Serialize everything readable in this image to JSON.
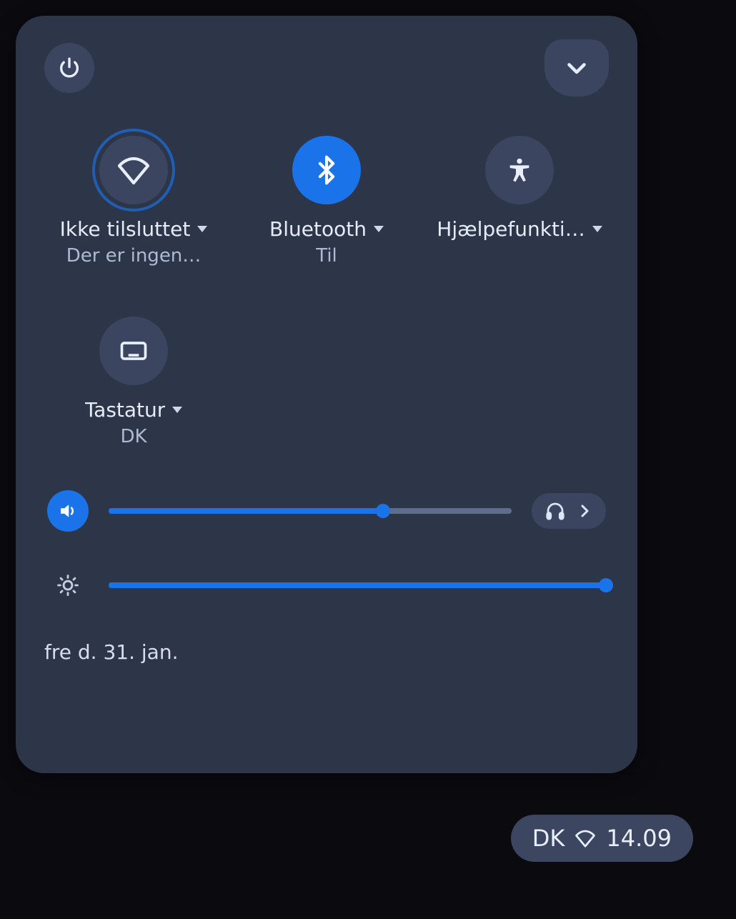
{
  "toggles": {
    "wifi": {
      "label": "Ikke tilsluttet",
      "sub": "Der er ingen…",
      "on": false
    },
    "bt": {
      "label": "Bluetooth",
      "sub": "Til",
      "on": true
    },
    "a11y": {
      "label": "Hjælpefunkti…",
      "sub": "",
      "on": false
    },
    "kbd": {
      "label": "Tastatur",
      "sub": "DK",
      "on": false
    }
  },
  "sliders": {
    "volume_pct": 68,
    "brightness_pct": 100
  },
  "date": "fre d. 31. jan.",
  "tray": {
    "ime": "DK",
    "clock": "14.09"
  },
  "colors": {
    "accent": "#1a73e8",
    "panel": "#2d3548",
    "chip": "#3b4560"
  }
}
